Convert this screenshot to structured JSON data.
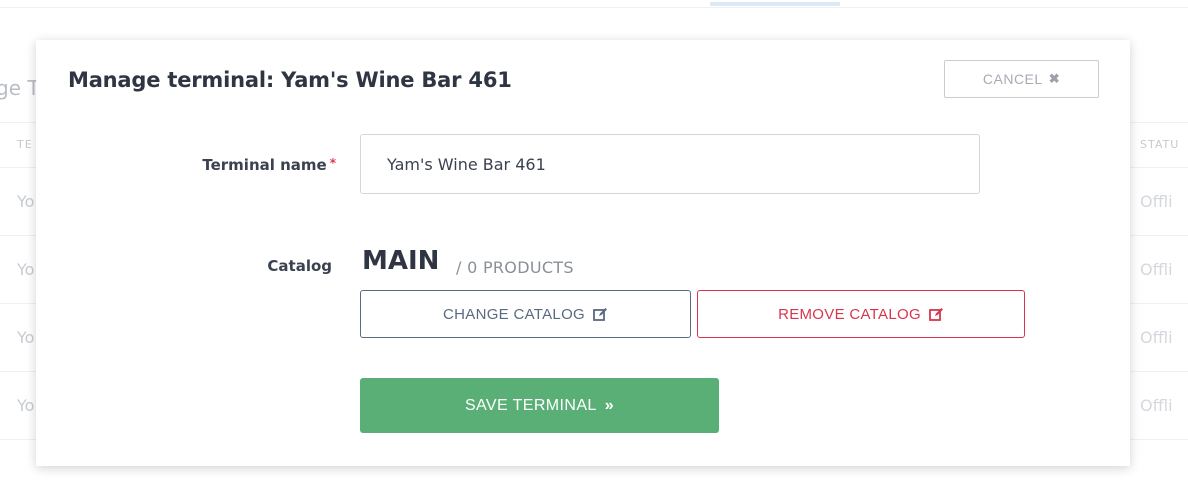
{
  "background": {
    "title_fragment": "ge T",
    "columns": {
      "left": "TE",
      "right": "STATU"
    },
    "rows": [
      {
        "left": "Yo",
        "right": "Offli"
      },
      {
        "left": "Yo",
        "right": "Offli"
      },
      {
        "left": "Yo",
        "right": "Offli"
      },
      {
        "left": "Yo",
        "right": "Offli"
      }
    ]
  },
  "modal": {
    "title": "Manage terminal: Yam's Wine Bar 461",
    "cancel_label": "CANCEL",
    "cancel_icon": "✖",
    "terminal_name_label": "Terminal name",
    "required_marker": "*",
    "terminal_name_value": "Yam's Wine Bar 461",
    "catalog_label": "Catalog",
    "catalog_name": "MAIN",
    "catalog_count": "/ 0 PRODUCTS",
    "change_catalog_label": "CHANGE CATALOG",
    "remove_catalog_label": "REMOVE CATALOG",
    "save_label": "SAVE TERMINAL",
    "save_icon": "»"
  },
  "colors": {
    "save_green": "#5aaf77",
    "remove_red": "#d8364f",
    "change_slate": "#5c6b80",
    "required_red": "#e0394f"
  },
  "icons": [
    "close-icon",
    "edit-icon",
    "double-chevron-right-icon"
  ]
}
